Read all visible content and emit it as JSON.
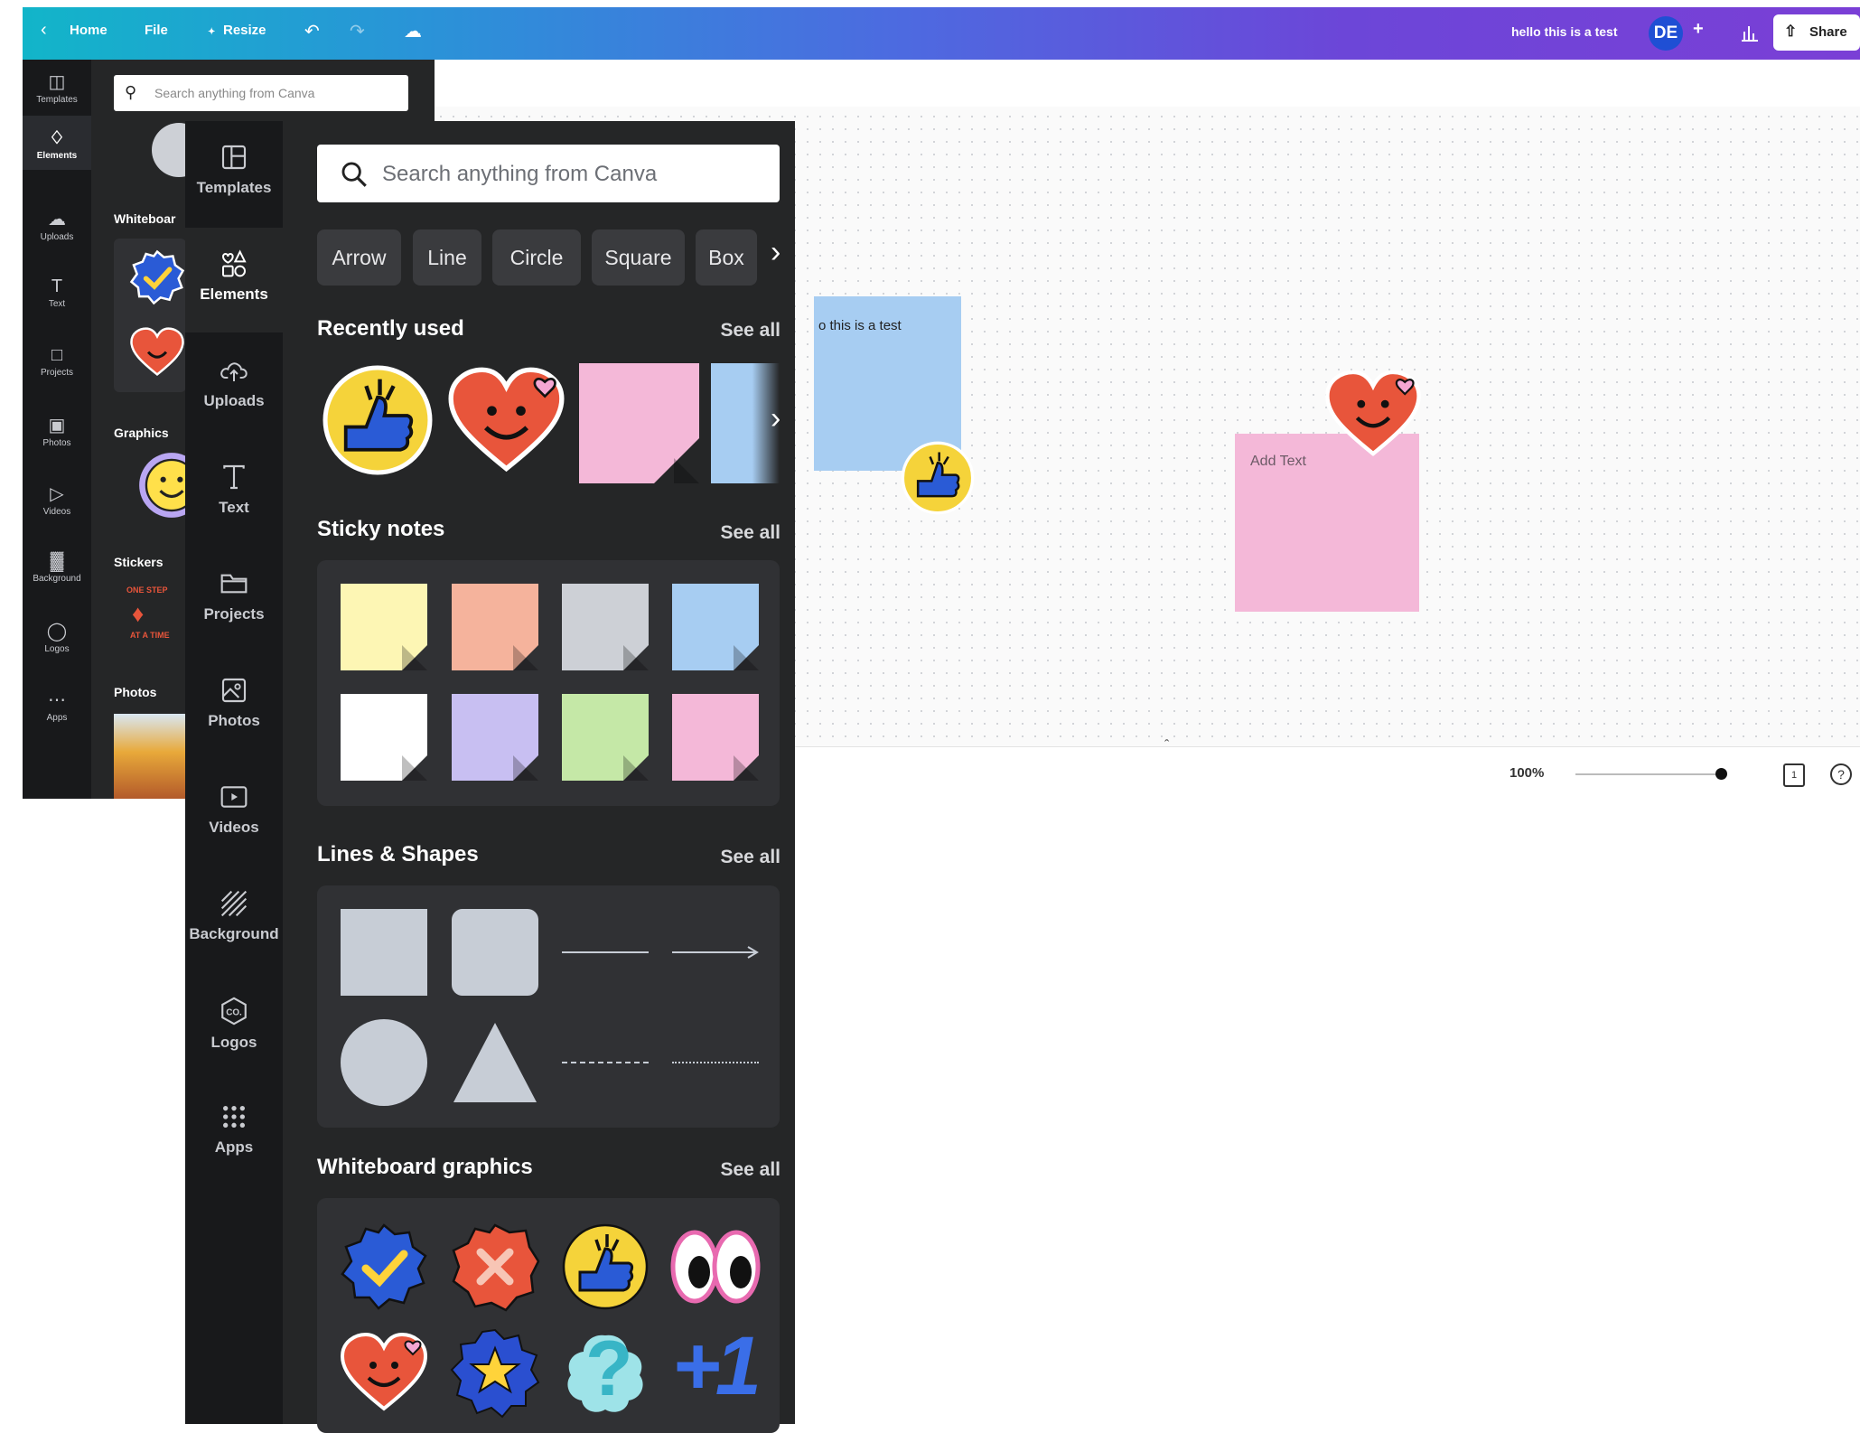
{
  "topbar": {
    "home_label": "Home",
    "file_label": "File",
    "resize_label": "Resize",
    "doc_title": "hello this is a test",
    "avatar_initials": "DE",
    "add_label": "+",
    "share_label": "Share"
  },
  "small_rail": [
    "Templates",
    "Elements",
    "Uploads",
    "Text",
    "Projects",
    "Photos",
    "Videos",
    "Background",
    "Logos",
    "Apps"
  ],
  "small_panel": {
    "search_placeholder": "Search anything from Canva",
    "sections": [
      "Whiteboar",
      "Graphics",
      "Stickers",
      "Photos"
    ],
    "sticker_top": "ONE STEP",
    "sticker_bottom": "AT A TIME"
  },
  "canvas": {
    "blue_note_text": "o this is a test",
    "pink_note_text": "Add Text",
    "zoom_label": "100%",
    "page_count": "1"
  },
  "rail": {
    "items": [
      "Templates",
      "Elements",
      "Uploads",
      "Text",
      "Projects",
      "Photos",
      "Videos",
      "Background",
      "Logos",
      "Apps"
    ],
    "active": "Elements"
  },
  "panel": {
    "search_placeholder": "Search anything from Canva",
    "chips": [
      "Arrow",
      "Line",
      "Circle",
      "Square",
      "Box"
    ],
    "sections": {
      "recent": "Recently used",
      "sticky": "Sticky notes",
      "shapes": "Lines & Shapes",
      "wb": "Whiteboard graphics"
    },
    "see_all": "See all",
    "plus_one_label": "+1",
    "question_mark": "?"
  },
  "colors": {
    "sticky_notes": [
      "#fdf6b4",
      "#f5b39c",
      "#cdd0d6",
      "#a7cdf2",
      "#ffffff",
      "#c8bff2",
      "#c5e8a7",
      "#f4b8d8"
    ],
    "shape_fill": "#c7cdd6",
    "panel_bg": "#252627",
    "rail_bg": "#18191b"
  }
}
